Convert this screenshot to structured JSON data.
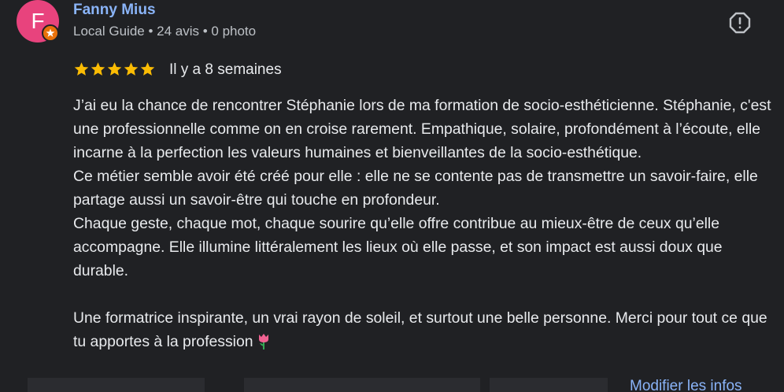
{
  "reviewer": {
    "avatar_letter": "F",
    "name": "Fanny Mius",
    "meta": "Local Guide • 24 avis • 0 photo"
  },
  "review": {
    "rating": 5,
    "max_rating": 5,
    "date": "Il y a 8 semaines",
    "paragraphs": [
      "J’ai eu la chance de rencontrer Stéphanie lors de ma formation de socio-esthéticienne. Stéphanie, c'est une professionnelle comme on en croise rarement. Empathique, solaire, profondément à l’écoute, elle incarne à la perfection les valeurs humaines et bienveillantes de la socio-esthétique.",
      "Ce métier semble avoir été créé pour elle : elle ne se contente pas de transmettre un savoir-faire, elle partage aussi un savoir-être qui touche en profondeur.",
      "Chaque geste, chaque mot, chaque sourire qu’elle offre contribue au mieux-être de ceux qu’elle accompagne. Elle illumine littéralement les lieux où elle passe, et son impact est aussi doux que durable.",
      "Une formatrice inspirante, un vrai rayon de soleil, et surtout une belle personne. Merci pour tout ce que tu apportes à la profession"
    ]
  },
  "footer": {
    "edit_info": "Modifier les infos"
  },
  "icons": {
    "badge": "local-guide-badge-icon",
    "flag": "report-flag-icon",
    "star": "star-icon",
    "emoji": "tulip-icon"
  },
  "colors": {
    "background": "#202124",
    "avatar": "#e8437d",
    "name": "#8ab4f8",
    "star": "#fbbc04",
    "badge": "#e8710a"
  }
}
